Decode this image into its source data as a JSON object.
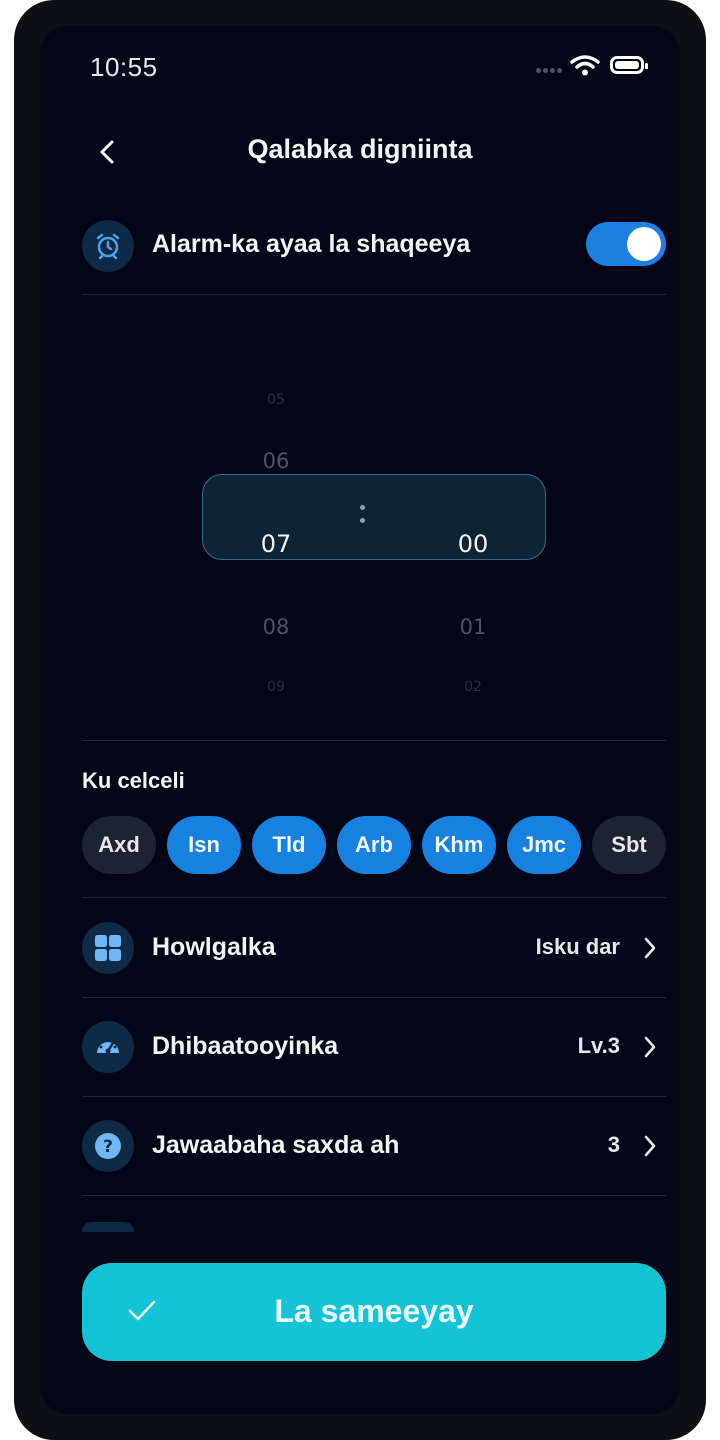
{
  "status_bar": {
    "time": "10:55"
  },
  "header": {
    "title": "Qalabka digniinta"
  },
  "alarm": {
    "label": "Alarm-ka ayaa la shaqeeya",
    "enabled": true
  },
  "picker": {
    "hours_above": [
      "05",
      "06"
    ],
    "hour_selected": "07",
    "hours_below": [
      "08",
      "09"
    ],
    "minute_selected": "00",
    "minutes_below": [
      "01",
      "02"
    ]
  },
  "repeat": {
    "label": "Ku celceli",
    "days": [
      {
        "label": "Axd",
        "active": false
      },
      {
        "label": "Isn",
        "active": true
      },
      {
        "label": "Tld",
        "active": true
      },
      {
        "label": "Arb",
        "active": true
      },
      {
        "label": "Khm",
        "active": true
      },
      {
        "label": "Jmc",
        "active": true
      },
      {
        "label": "Sbt",
        "active": false
      }
    ]
  },
  "settings": [
    {
      "label": "Howlgalka",
      "value": "Isku dar",
      "icon": "grid-icon"
    },
    {
      "label": "Dhibaatooyinka",
      "value": "Lv.3",
      "icon": "speedometer-icon"
    },
    {
      "label": "Jawaabaha saxda ah",
      "value": "3",
      "icon": "question-icon"
    }
  ],
  "cta": {
    "label": "La sameeyay"
  },
  "colors": {
    "accent": "#1781e0",
    "cta": "#14c4d6",
    "background": "#020617"
  }
}
